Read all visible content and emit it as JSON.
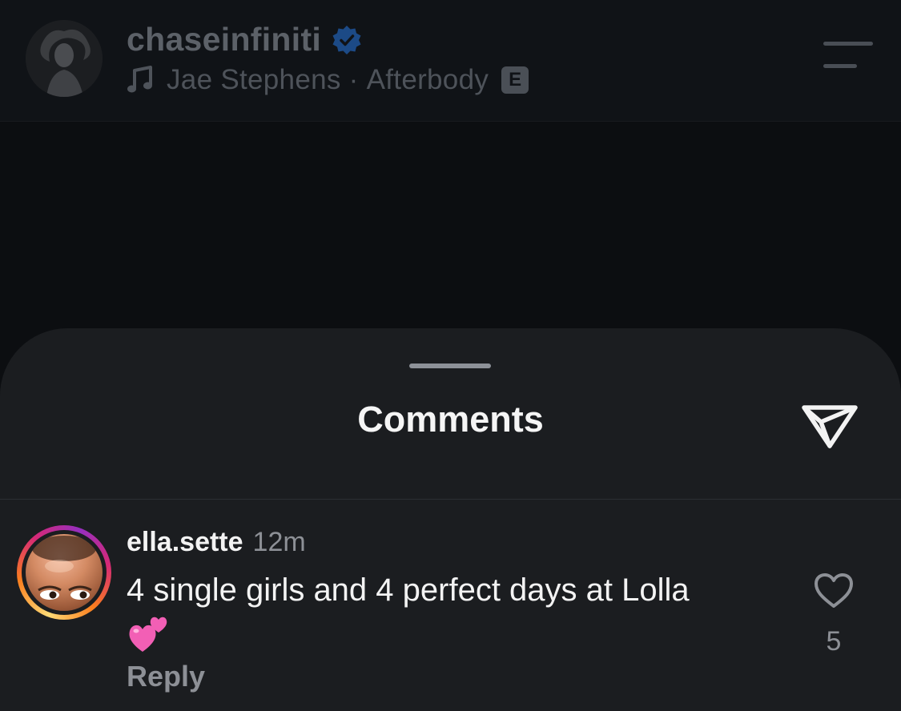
{
  "post_header": {
    "username": "chaseinfiniti",
    "verified_icon": "verified-badge-icon",
    "music_icon": "music-note-icon",
    "song_artist": "Jae Stephens",
    "song_separator": "·",
    "song_title": "Afterbody",
    "explicit_label": "E",
    "menu_icon": "hamburger-menu-icon"
  },
  "comments_sheet": {
    "title": "Comments",
    "share_icon": "paper-plane-icon",
    "comments": [
      {
        "username": "ella.sette",
        "time": "12m",
        "text": "4 single girls and 4 perfect days at Lolla",
        "emoji": "two-hearts-icon",
        "reply_label": "Reply",
        "likes": "5",
        "like_icon": "heart-outline-icon"
      }
    ]
  },
  "colors": {
    "background": "#0c0e11",
    "header_bg": "#101317",
    "sheet_bg": "#1b1d20",
    "verified_blue": "#1c4a86",
    "primary_text": "#f3f3f3",
    "secondary_text": "#8d9096"
  }
}
